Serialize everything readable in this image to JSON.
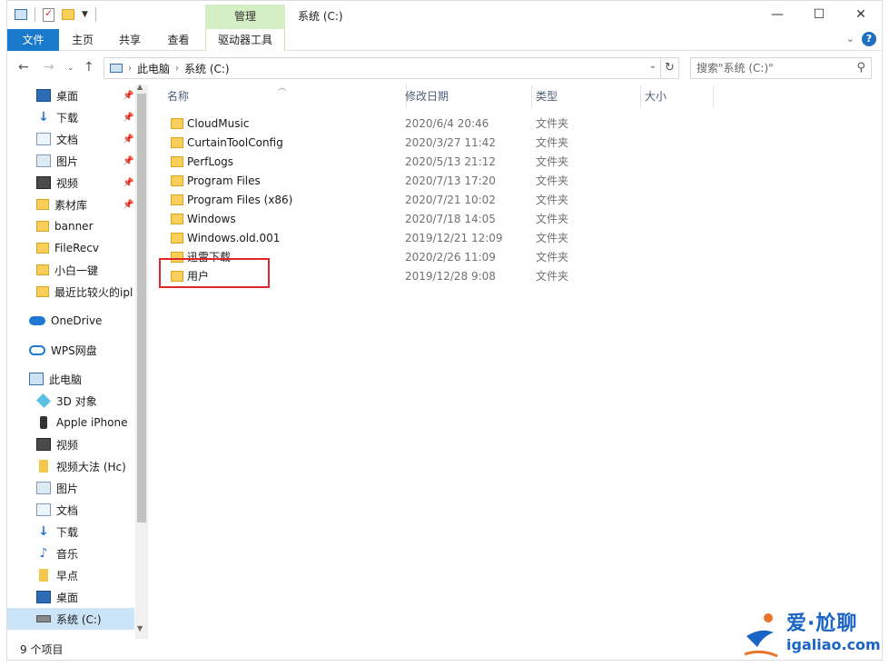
{
  "window": {
    "title": "系统 (C:)",
    "controls": [
      "—",
      "☐",
      "✕"
    ]
  },
  "ribbon": {
    "manage_label": "管理",
    "tabs": [
      "文件",
      "主页",
      "共享",
      "查看"
    ],
    "drive_tools_label": "驱动器工具"
  },
  "address": {
    "crumbs": [
      "此电脑",
      "系统 (C:)"
    ]
  },
  "search": {
    "placeholder": "搜索\"系统 (C:)\""
  },
  "nav": {
    "items": [
      {
        "label": "桌面",
        "icon": "desktop-icon",
        "pinned": true
      },
      {
        "label": "下载",
        "icon": "download-icon",
        "pinned": true
      },
      {
        "label": "文档",
        "icon": "document-icon",
        "pinned": true
      },
      {
        "label": "图片",
        "icon": "pictures-icon",
        "pinned": true
      },
      {
        "label": "视频",
        "icon": "video-icon",
        "pinned": true
      },
      {
        "label": "素材库",
        "icon": "folder-icon",
        "pinned": true
      },
      {
        "label": "banner",
        "icon": "folder-icon",
        "pinned": false
      },
      {
        "label": "FileRecv",
        "icon": "folder-icon",
        "pinned": false
      },
      {
        "label": "小白一键",
        "icon": "folder-icon",
        "pinned": false
      },
      {
        "label": "最近比较火的ipl",
        "icon": "folder-icon",
        "pinned": false
      },
      {
        "label": "OneDrive",
        "icon": "onedrive-icon"
      },
      {
        "label": "WPS网盘",
        "icon": "wps-cloud-icon"
      },
      {
        "label": "此电脑",
        "icon": "this-pc-icon"
      },
      {
        "label": "3D 对象",
        "icon": "3d-objects-icon"
      },
      {
        "label": "Apple iPhone",
        "icon": "phone-icon"
      },
      {
        "label": "视频",
        "icon": "video-icon"
      },
      {
        "label": "视频大法 (Hc)",
        "icon": "drive-tag-icon"
      },
      {
        "label": "图片",
        "icon": "pictures-icon"
      },
      {
        "label": "文档",
        "icon": "document-icon"
      },
      {
        "label": "下载",
        "icon": "download-icon"
      },
      {
        "label": "音乐",
        "icon": "music-icon"
      },
      {
        "label": "早点",
        "icon": "drive-tag-icon"
      },
      {
        "label": "桌面",
        "icon": "desktop-icon"
      },
      {
        "label": "系统 (C:)",
        "icon": "drive-icon",
        "selected": true
      }
    ]
  },
  "columns": {
    "name": "名称",
    "date": "修改日期",
    "type": "类型",
    "size": "大小"
  },
  "files": [
    {
      "name": "CloudMusic",
      "date": "2020/6/4 20:46",
      "type": "文件夹"
    },
    {
      "name": "CurtainToolConfig",
      "date": "2020/3/27 11:42",
      "type": "文件夹"
    },
    {
      "name": "PerfLogs",
      "date": "2020/5/13 21:12",
      "type": "文件夹"
    },
    {
      "name": "Program Files",
      "date": "2020/7/13 17:20",
      "type": "文件夹"
    },
    {
      "name": "Program Files (x86)",
      "date": "2020/7/21 10:02",
      "type": "文件夹"
    },
    {
      "name": "Windows",
      "date": "2020/7/18 14:05",
      "type": "文件夹"
    },
    {
      "name": "Windows.old.001",
      "date": "2019/12/21 12:09",
      "type": "文件夹"
    },
    {
      "name": "迅雷下载",
      "date": "2020/2/26 11:09",
      "type": "文件夹"
    },
    {
      "name": "用户",
      "date": "2019/12/28 9:08",
      "type": "文件夹"
    }
  ],
  "status": {
    "count": "9 个项目"
  },
  "watermark": {
    "cn": "爱·尬聊",
    "en": "igaliao.com"
  },
  "colors": {
    "accent": "#1979ca",
    "manage_tab": "#d6eec4",
    "highlight": "#e0262b"
  }
}
